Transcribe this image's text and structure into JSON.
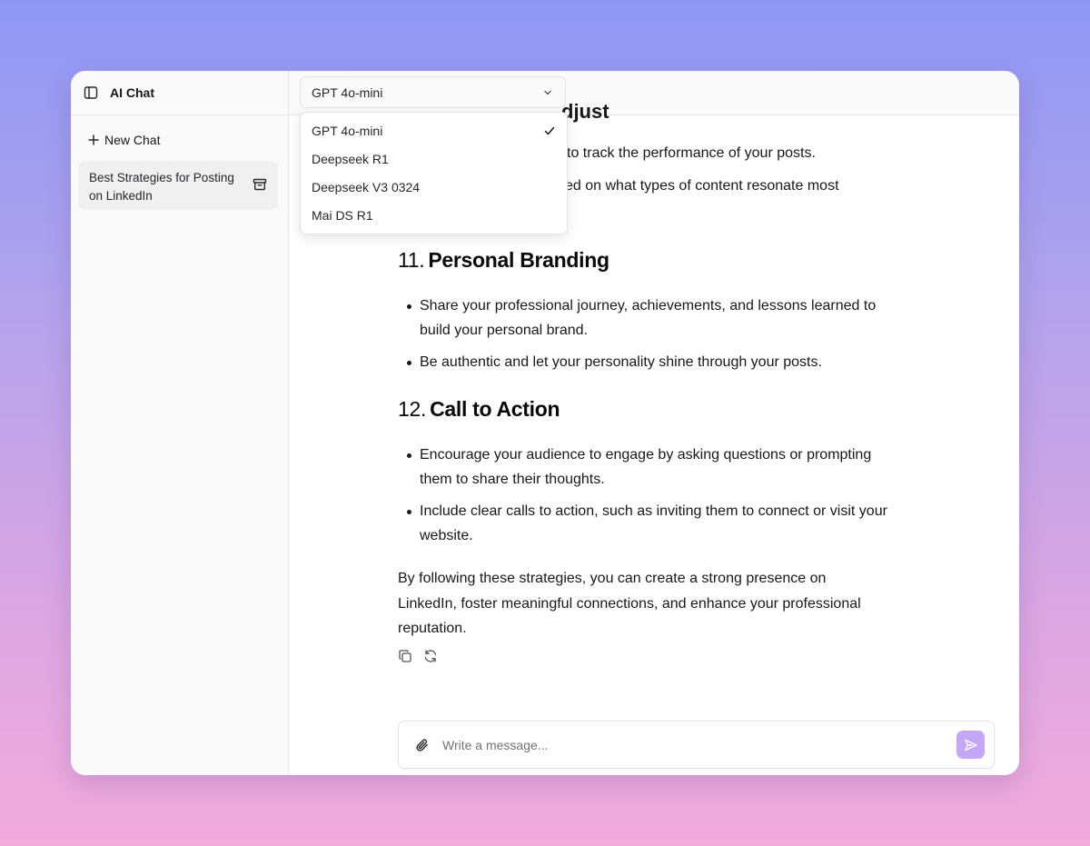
{
  "sidebar": {
    "app_title": "AI Chat",
    "new_chat_label": "New Chat",
    "chats": [
      {
        "title": "Best Strategies for Posting on LinkedIn"
      }
    ]
  },
  "model_select": {
    "selected": "GPT 4o-mini",
    "options": [
      "GPT 4o-mini",
      "Deepseek R1",
      "Deepseek V3 0324",
      "Mai DS R1"
    ]
  },
  "conversation": {
    "partial_heading": "djust",
    "partial_lines": [
      "to track the performance of your posts.",
      "sed on what types of content resonate most"
    ],
    "sections": [
      {
        "number": "11.",
        "title": "Personal Branding",
        "bullets": [
          "Share your professional journey, achievements, and lessons learned to build your personal brand.",
          "Be authentic and let your personality shine through your posts."
        ]
      },
      {
        "number": "12.",
        "title": "Call to Action",
        "bullets": [
          "Encourage your audience to engage by asking questions or prompting them to share their thoughts.",
          "Include clear calls to action, such as inviting them to connect or visit your website."
        ]
      }
    ],
    "summary": "By following these strategies, you can create a strong presence on LinkedIn, foster meaningful connections, and enhance your professional reputation."
  },
  "composer": {
    "placeholder": "Write a message..."
  },
  "colors": {
    "send_button": "#c4a8f7",
    "border": "#e4e4e7"
  }
}
